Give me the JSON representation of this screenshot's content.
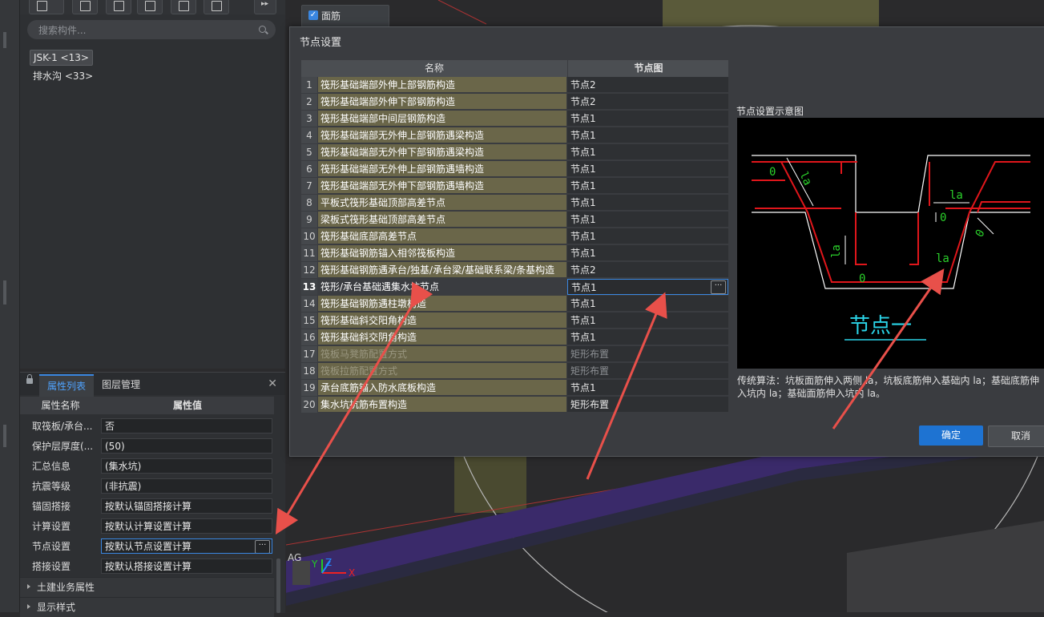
{
  "component_panel": {
    "search": {
      "placeholder": "搜索构件..."
    },
    "tree_items": [
      "JSK-1 <13>",
      "排水沟 <33>"
    ]
  },
  "property_panel": {
    "tabs": [
      "属性列表",
      "图层管理"
    ],
    "close_icon": "✕",
    "header": {
      "name_col": "属性名称",
      "value_col": "属性值"
    },
    "rows": [
      {
        "name": "取筏板/承台...",
        "value": "否"
      },
      {
        "name": "保护层厚度(...",
        "value": "(50)"
      },
      {
        "name": "汇总信息",
        "value": "(集水坑)"
      },
      {
        "name": "抗震等级",
        "value": "(非抗震)"
      },
      {
        "name": "锚固搭接",
        "value": "按默认锚固搭接计算"
      },
      {
        "name": "计算设置",
        "value": "按默认计算设置计算"
      },
      {
        "name": "节点设置",
        "value": "按默认节点设置计算"
      },
      {
        "name": "搭接设置",
        "value": "按默认搭接设置计算"
      }
    ],
    "groups": [
      "土建业务属性",
      "显示样式"
    ]
  },
  "viewport": {
    "rebar_checkbox": {
      "label": "面筋",
      "checked": true
    },
    "axis_labels": {
      "x": "X",
      "y": "Y",
      "z": "Z",
      "corner": "AG"
    }
  },
  "dialog": {
    "title": "节点设置",
    "table": {
      "headers": {
        "name": "名称",
        "node": "节点图"
      },
      "rows": [
        {
          "num": "1",
          "name": "筏形基础端部外伸上部钢筋构造",
          "node": "节点2",
          "disabled": false
        },
        {
          "num": "2",
          "name": "筏形基础端部外伸下部钢筋构造",
          "node": "节点2",
          "disabled": false
        },
        {
          "num": "3",
          "name": "筏形基础端部中间层钢筋构造",
          "node": "节点1",
          "disabled": false
        },
        {
          "num": "4",
          "name": "筏形基础端部无外伸上部钢筋遇梁构造",
          "node": "节点1",
          "disabled": false
        },
        {
          "num": "5",
          "name": "筏形基础端部无外伸下部钢筋遇梁构造",
          "node": "节点1",
          "disabled": false
        },
        {
          "num": "6",
          "name": "筏形基础端部无外伸上部钢筋遇墙构造",
          "node": "节点1",
          "disabled": false
        },
        {
          "num": "7",
          "name": "筏形基础端部无外伸下部钢筋遇墙构造",
          "node": "节点1",
          "disabled": false
        },
        {
          "num": "8",
          "name": "平板式筏形基础顶部高差节点",
          "node": "节点1",
          "disabled": false
        },
        {
          "num": "9",
          "name": "梁板式筏形基础顶部高差节点",
          "node": "节点1",
          "disabled": false
        },
        {
          "num": "10",
          "name": "筏形基础底部高差节点",
          "node": "节点1",
          "disabled": false
        },
        {
          "num": "11",
          "name": "筏形基础钢筋锚入相邻筏板构造",
          "node": "节点1",
          "disabled": false
        },
        {
          "num": "12",
          "name": "筏形基础钢筋遇承台/独基/承台梁/基础联系梁/条基构造",
          "node": "节点2",
          "disabled": false
        },
        {
          "num": "13",
          "name": "筏形/承台基础遇集水坑节点",
          "node": "节点1",
          "disabled": false,
          "selected": true
        },
        {
          "num": "14",
          "name": "筏形基础钢筋遇柱墩构造",
          "node": "节点1",
          "disabled": false
        },
        {
          "num": "15",
          "name": "筏形基础斜交阳角构造",
          "node": "节点1",
          "disabled": false
        },
        {
          "num": "16",
          "name": "筏形基础斜交阴角构造",
          "node": "节点1",
          "disabled": false
        },
        {
          "num": "17",
          "name": "筏板马凳筋配置方式",
          "node": "矩形布置",
          "disabled": true
        },
        {
          "num": "18",
          "name": "筏板拉筋配置方式",
          "node": "矩形布置",
          "disabled": true
        },
        {
          "num": "19",
          "name": "承台底筋锚入防水底板构造",
          "node": "节点1",
          "disabled": false
        },
        {
          "num": "20",
          "name": "集水坑抗筋布置构造",
          "node": "矩形布置",
          "disabled": false
        }
      ]
    },
    "diagram": {
      "title": "节点设置示意图",
      "node_label": "节点一",
      "dim_labels": {
        "la": "la",
        "zero": "0"
      },
      "description": "传统算法：坑板面筋伸入两侧 la，坑板底筋伸入基础内 la；基础底筋伸入坑内 la；基础面筋伸入坑内 la。"
    },
    "buttons": {
      "ok": "确定",
      "cancel": "取消"
    }
  },
  "colors": {
    "accent": "#1e73d2",
    "annotation_arrow": "#e8504a",
    "rebar": "#e0161b",
    "dimension": "#2bd12b",
    "node_label": "#2ad4e8"
  }
}
